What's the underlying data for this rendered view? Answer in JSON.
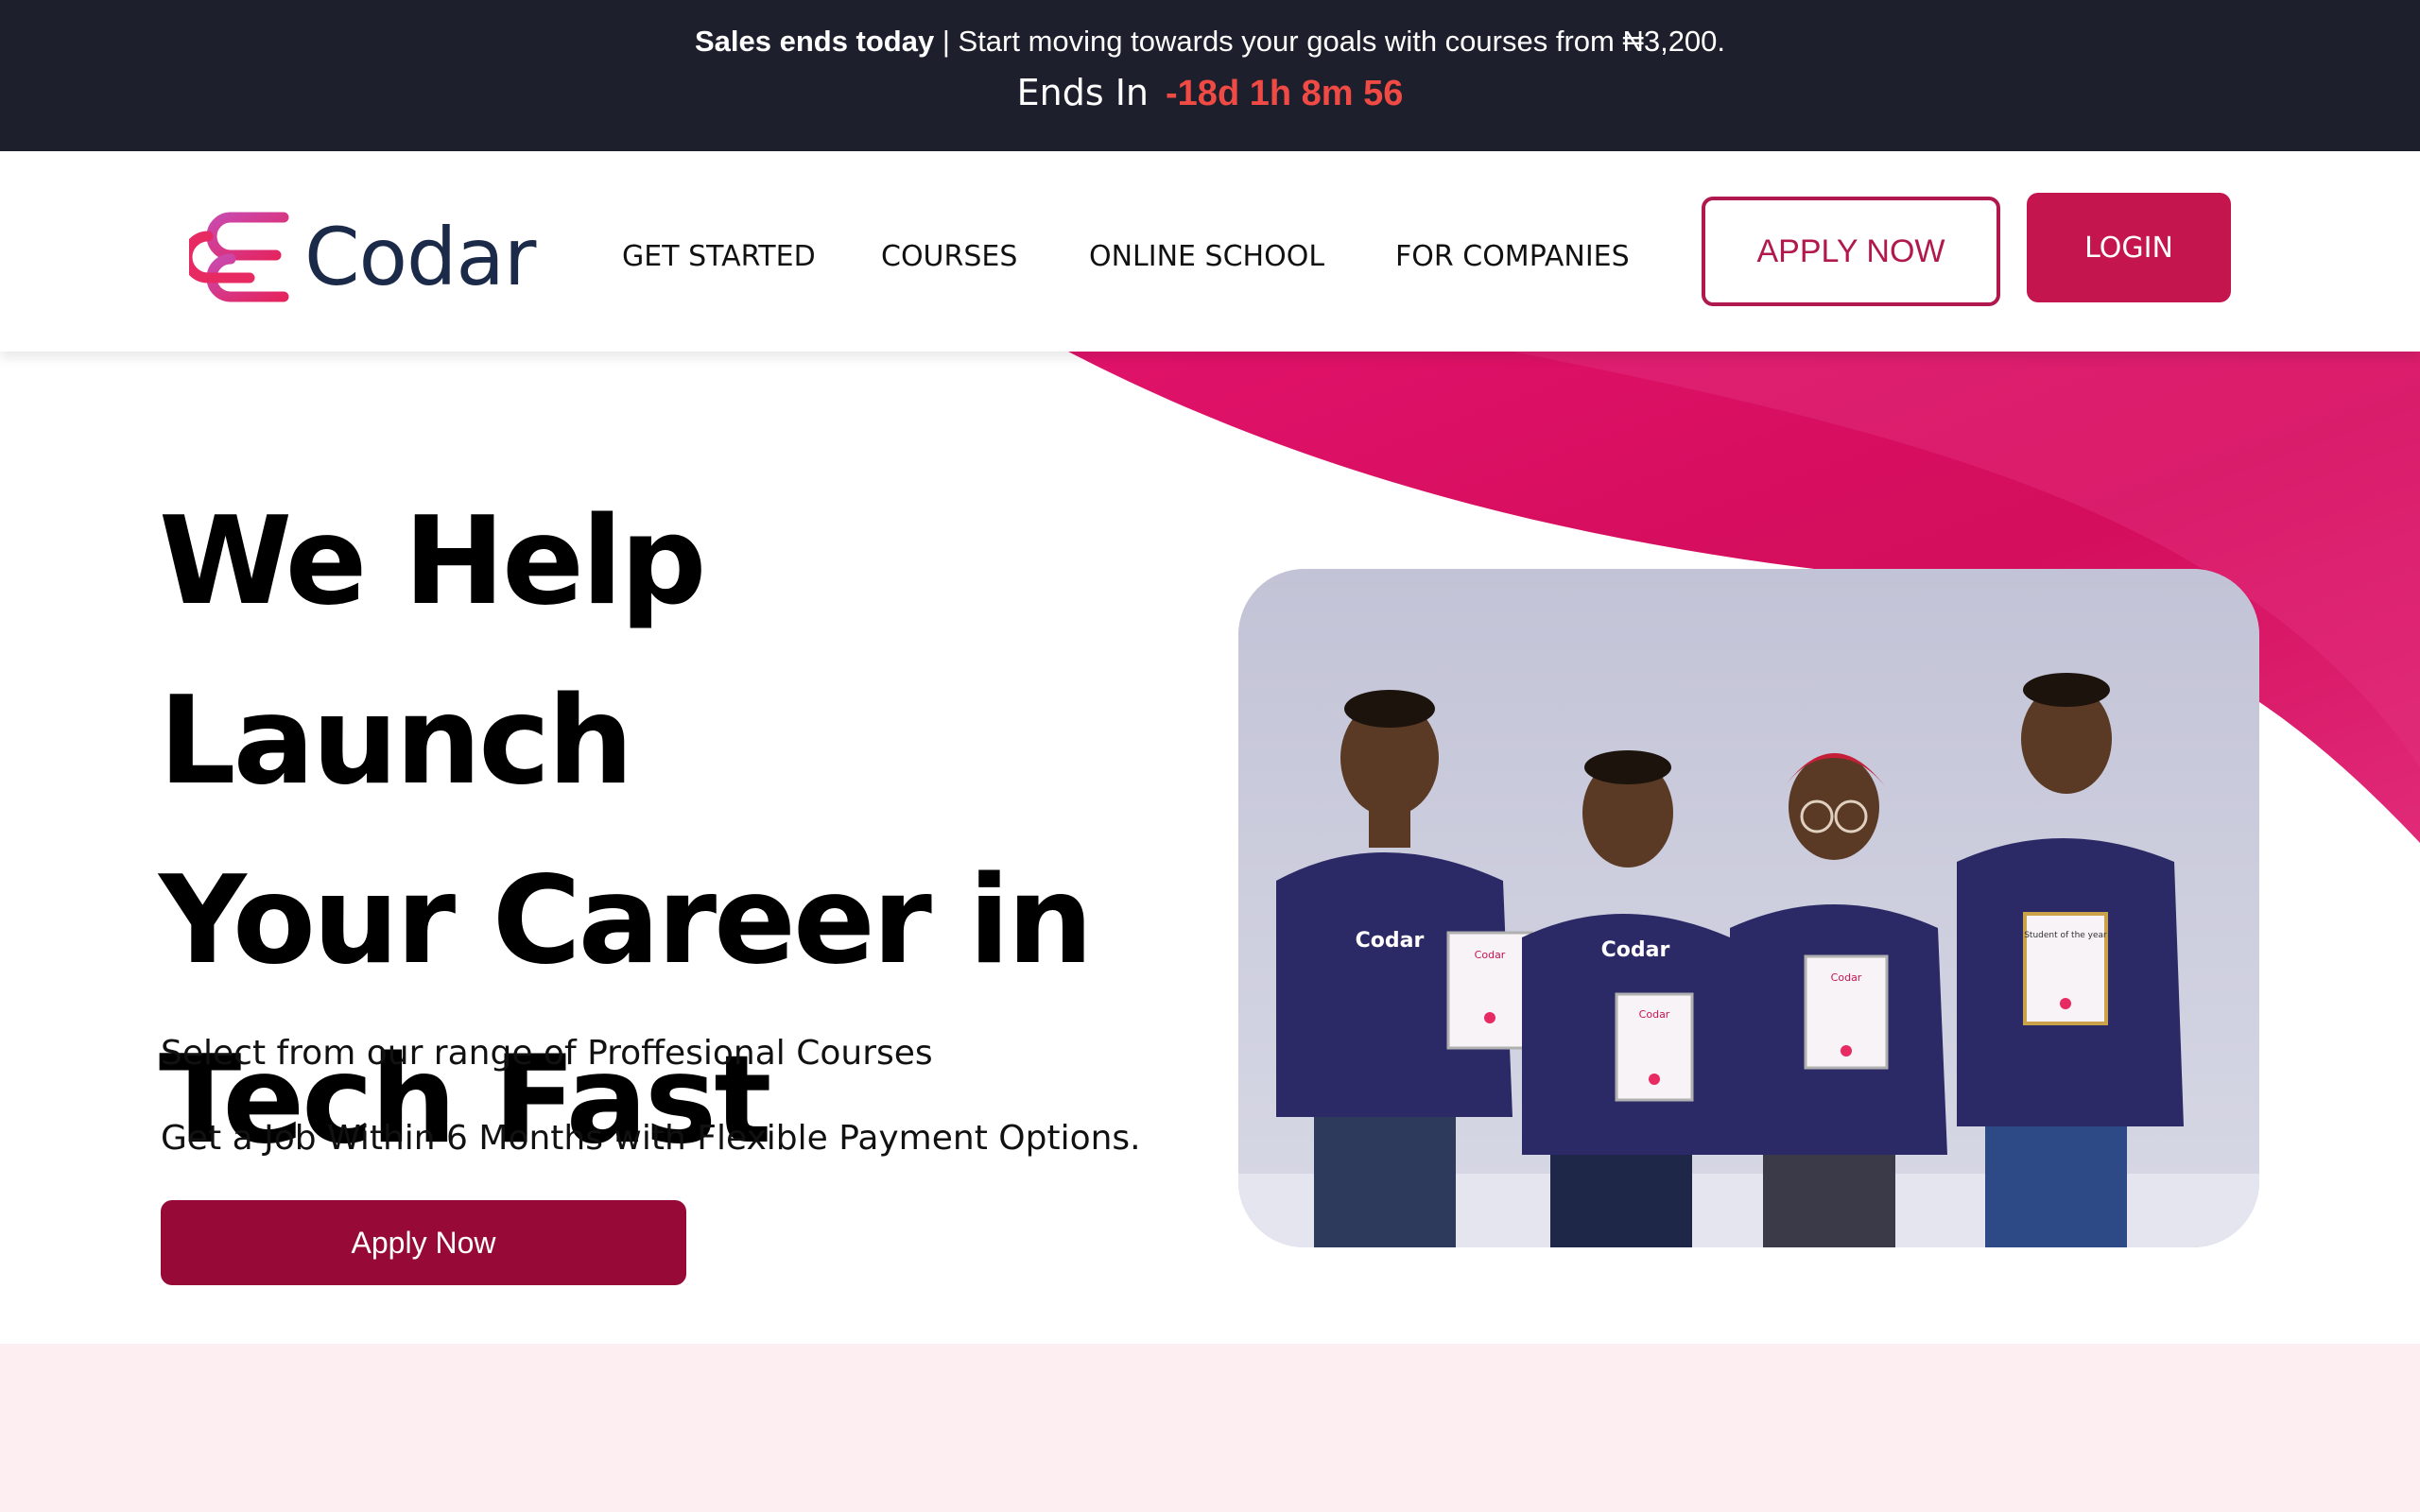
{
  "promo": {
    "headline_bold": "Sales ends today",
    "headline_rest": " | Start moving towards your goals with courses from ₦3,200.",
    "ends_label": "Ends In",
    "countdown": "-18d 1h 8m 56"
  },
  "header": {
    "logo_text": "Codar",
    "nav": [
      "GET STARTED",
      "COURSES",
      "ONLINE SCHOOL",
      "FOR COMPANIES"
    ],
    "apply_label": "APPLY NOW",
    "login_label": "LOGIN"
  },
  "hero": {
    "title_lines": [
      "We Help Launch",
      "Your Career in",
      "Tech Fast"
    ],
    "subtitle_1": "Select from our range of Proffesional Courses",
    "subtitle_2": "Get a Job Within 6 Months with Flexible Payment Options.",
    "cta_label": "Apply Now",
    "photo": {
      "shirt_text": "Codar",
      "plaque_texts": [
        "Codar",
        "Codar",
        "Codar",
        "Student of the year"
      ]
    }
  },
  "colors": {
    "promo_bg": "#1e1f2c",
    "countdown": "#f04a45",
    "brand_pink": "#c4154f",
    "cta_dark": "#970a38",
    "wave_pink": "#d4105f",
    "logo_text": "#1b2a48",
    "bottom_band": "#fdeef2"
  },
  "icons": [
    "codar-logo-icon"
  ]
}
